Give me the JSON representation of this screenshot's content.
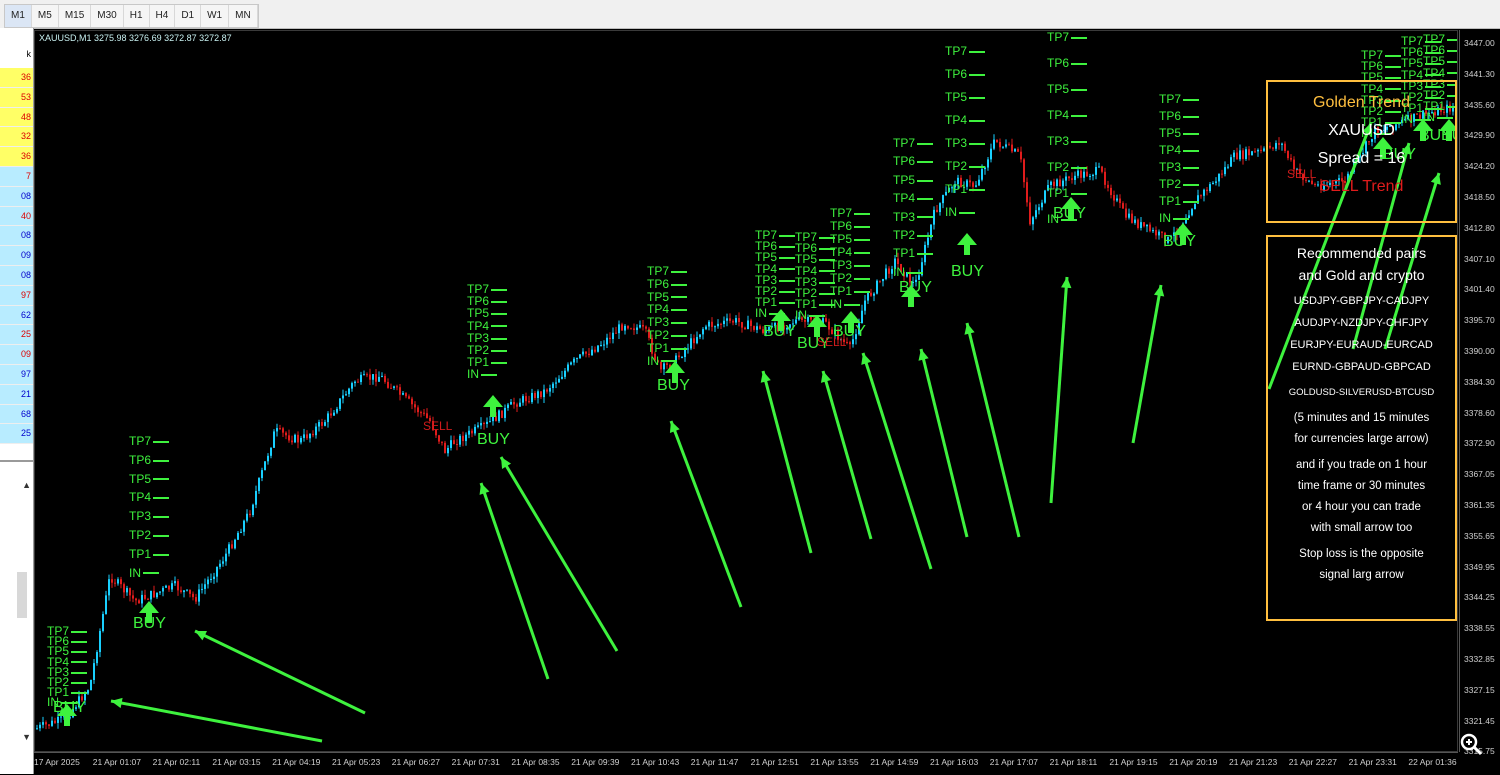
{
  "toolbar": {
    "timeframes": [
      "M1",
      "M5",
      "M15",
      "M30",
      "H1",
      "H4",
      "D1",
      "W1",
      "MN"
    ]
  },
  "market_watch": {
    "header": "k",
    "values": [
      "36",
      "53",
      "48",
      "32",
      "36",
      "7",
      "08",
      "40",
      "08",
      "09",
      "08",
      "97",
      "62",
      "25",
      "09",
      "97",
      "21",
      "68",
      "25"
    ]
  },
  "chart": {
    "title": "XAUUSD,M1  3275.98 3276.69 3272.87 3272.87",
    "price_axis": [
      "3447.00",
      "3441.30",
      "3435.60",
      "3429.90",
      "3424.20",
      "3418.50",
      "3412.80",
      "3407.10",
      "3401.40",
      "3395.70",
      "3390.00",
      "3384.30",
      "3378.60",
      "3372.90",
      "3367.05",
      "3361.35",
      "3355.65",
      "3349.95",
      "3344.25",
      "3338.55",
      "3332.85",
      "3327.15",
      "3321.45",
      "3315.75"
    ],
    "time_axis": [
      "17 Apr 2025",
      "21 Apr 01:07",
      "21 Apr 02:11",
      "21 Apr 03:15",
      "21 Apr 04:19",
      "21 Apr 05:23",
      "21 Apr 06:27",
      "21 Apr 07:31",
      "21 Apr 08:35",
      "21 Apr 09:39",
      "21 Apr 10:43",
      "21 Apr 11:47",
      "21 Apr 12:51",
      "21 Apr 13:55",
      "21 Apr 14:59",
      "21 Apr 16:03",
      "21 Apr 17:07",
      "21 Apr 18:11",
      "21 Apr 19:15",
      "21 Apr 20:19",
      "21 Apr 21:23",
      "21 Apr 22:27",
      "21 Apr 23:31",
      "22 Apr 01:36"
    ]
  },
  "signals": {
    "tp_labels": [
      "TP7",
      "TP6",
      "TP5",
      "TP4",
      "TP3",
      "TP2",
      "TP1",
      "IN"
    ],
    "buy_label": "BUY",
    "sell_label": "SELL"
  },
  "info_box": {
    "title": "Golden Trend",
    "symbol": "XAUUSD",
    "spread": "Spread = 16",
    "trend": "SELL Trend",
    "colors": {
      "title": "#ffbf3f",
      "trend": "#e01c1c",
      "border": "#ffbf3f"
    }
  },
  "recommendation": {
    "heading1": "Recommended pairs",
    "heading2": "and Gold and crypto",
    "pairs": [
      "USDJPY-GBPJPY-CADJPY",
      "AUDJPY-NZDJPY-CHFJPY",
      "EURJPY-EURAUD-EURCAD",
      "EURND-GBPAUD-GBPCAD",
      "GOLDUSD-SILVERUSD-BTCUSD"
    ],
    "note1": "(5 minutes and 15 minutes",
    "note2": "for currencies large arrow)",
    "note3": "and if you trade on 1 hour",
    "note4": "time frame or 30 minutes",
    "note5": "or 4 hour you can trade",
    "note6": "with small arrow too",
    "note7": "Stop loss is the opposite",
    "note8": "signal larg arrow"
  },
  "colors": {
    "bull": "#19d0ff",
    "bear": "#e01c1c",
    "signal": "#3ef23e"
  }
}
